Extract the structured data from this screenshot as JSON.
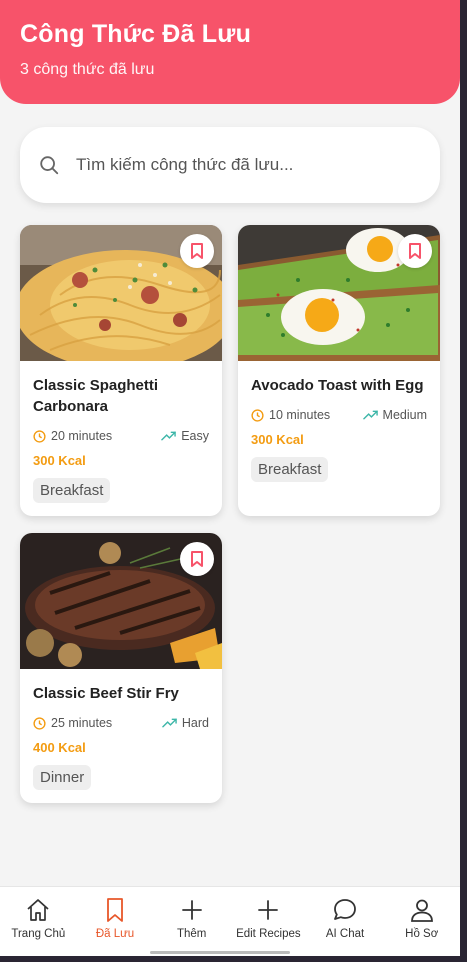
{
  "header": {
    "title": "Công Thức Đã Lưu",
    "subtitle": "3 công thức đã lưu"
  },
  "search": {
    "placeholder": "Tìm kiếm công thức đã lưu...",
    "value": ""
  },
  "recipes": [
    {
      "title": "Classic Spaghetti Carbonara",
      "time": "20 minutes",
      "difficulty": "Easy",
      "kcal": "300 Kcal",
      "tag": "Breakfast"
    },
    {
      "title": "Avocado Toast with Egg",
      "time": "10 minutes",
      "difficulty": "Medium",
      "kcal": "300 Kcal",
      "tag": "Breakfast"
    },
    {
      "title": "Classic Beef Stir Fry",
      "time": "25 minutes",
      "difficulty": "Hard",
      "kcal": "400 Kcal",
      "tag": "Dinner"
    }
  ],
  "nav": [
    {
      "label": "Trang Chủ",
      "icon": "home-icon"
    },
    {
      "label": "Đã Lưu",
      "icon": "bookmark-icon",
      "active": true
    },
    {
      "label": "Thêm",
      "icon": "plus-icon"
    },
    {
      "label": "Edit Recipes",
      "icon": "plus-icon"
    },
    {
      "label": "AI Chat",
      "icon": "chat-icon"
    },
    {
      "label": "Hồ Sơ",
      "icon": "user-icon"
    }
  ],
  "colors": {
    "header": "#f7536a",
    "accent_orange": "#f39c12",
    "active_nav": "#e8572a",
    "bookmark": "#f7536a"
  }
}
